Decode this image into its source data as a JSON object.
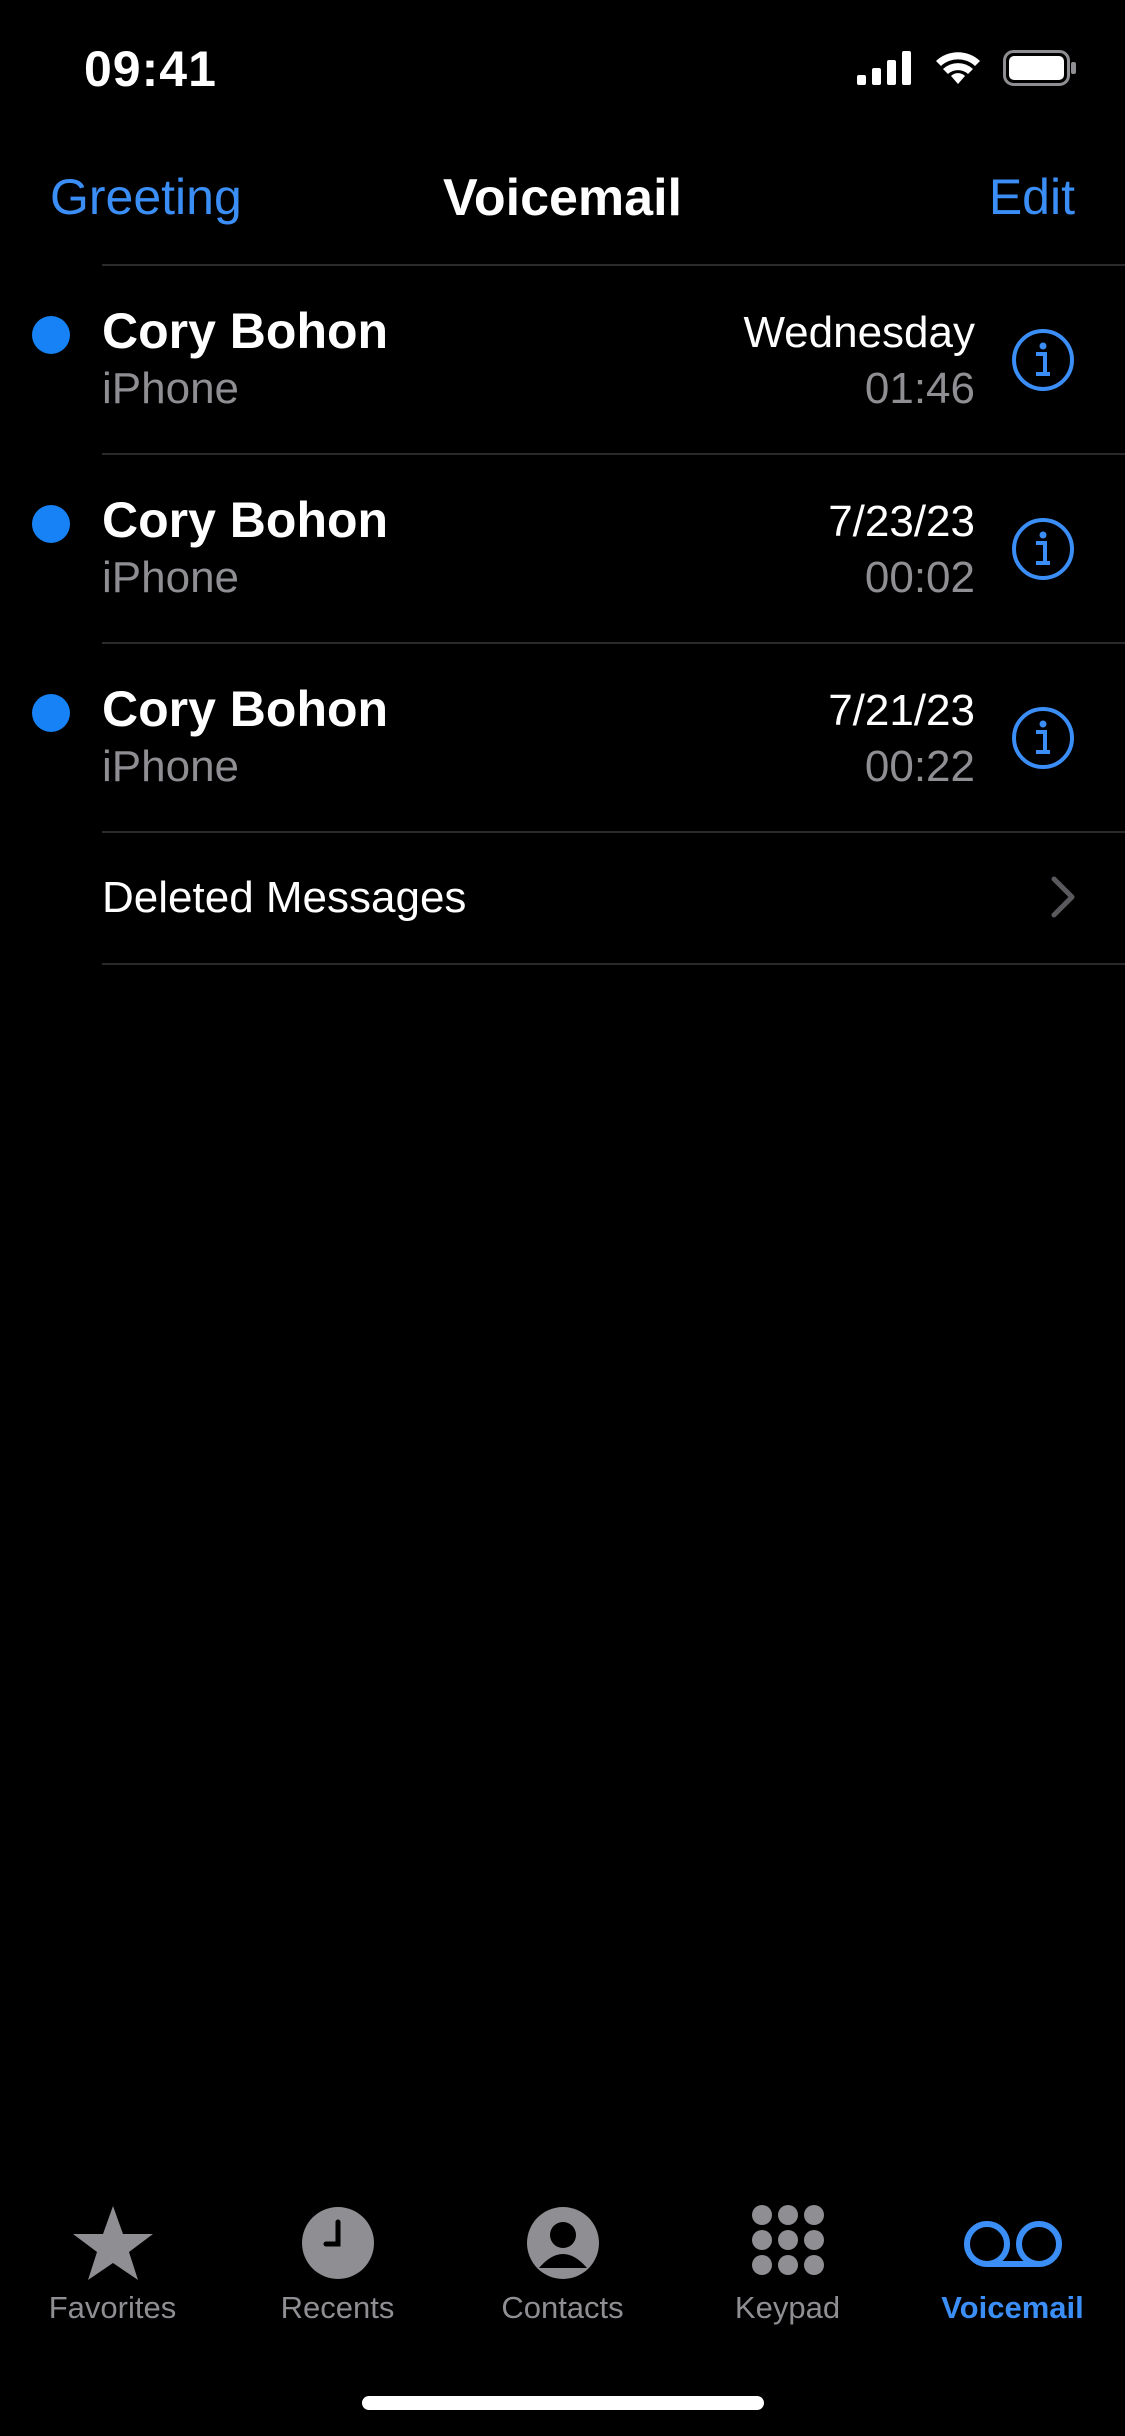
{
  "status": {
    "time": "09:41"
  },
  "nav": {
    "left": "Greeting",
    "title": "Voicemail",
    "right": "Edit"
  },
  "voicemails": [
    {
      "name": "Cory Bohon",
      "source": "iPhone",
      "date": "Wednesday",
      "duration": "01:46",
      "unread": true
    },
    {
      "name": "Cory Bohon",
      "source": "iPhone",
      "date": "7/23/23",
      "duration": "00:02",
      "unread": true
    },
    {
      "name": "Cory Bohon",
      "source": "iPhone",
      "date": "7/21/23",
      "duration": "00:22",
      "unread": true
    }
  ],
  "deleted": {
    "label": "Deleted Messages"
  },
  "tabs": [
    {
      "label": "Favorites",
      "icon": "star-icon"
    },
    {
      "label": "Recents",
      "icon": "clock-icon"
    },
    {
      "label": "Contacts",
      "icon": "person-circle-icon"
    },
    {
      "label": "Keypad",
      "icon": "keypad-icon"
    },
    {
      "label": "Voicemail",
      "icon": "voicemail-icon",
      "active": true
    }
  ],
  "colors": {
    "accent": "#3a8ef6",
    "unread": "#1782f6",
    "secondary": "#8e8e93"
  }
}
